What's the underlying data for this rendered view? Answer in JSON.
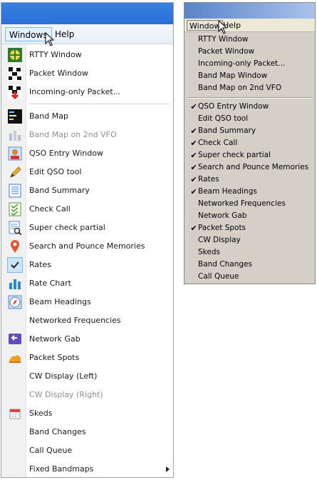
{
  "left_window": {
    "menubar": {
      "windows_label": "Windows",
      "help_label": "Help"
    },
    "menu_items": [
      {
        "label": "RTTY Window",
        "icon": "rtty-icon"
      },
      {
        "label": "Packet Window",
        "icon": "packet-icon"
      },
      {
        "label": "Incoming-only Packet...",
        "icon": "incoming-packet-icon"
      },
      {
        "label": "Band Map",
        "icon": "band-map-icon"
      },
      {
        "label": "Band Map on 2nd VFO",
        "icon": "band-map-2nd-vfo-icon",
        "disabled": true
      },
      {
        "label": "QSO Entry Window",
        "icon": "qso-entry-icon"
      },
      {
        "label": "Edit QSO tool",
        "icon": "pencil-icon"
      },
      {
        "label": "Band Summary",
        "icon": "band-summary-icon"
      },
      {
        "label": "Check Call",
        "icon": "check-call-icon"
      },
      {
        "label": "Super check partial",
        "icon": "super-check-partial-icon"
      },
      {
        "label": "Search and Pounce Memories",
        "icon": "map-pin-icon"
      },
      {
        "label": "Rates",
        "icon": "checkmark-icon",
        "checked": true
      },
      {
        "label": "Rate Chart",
        "icon": "rate-chart-icon"
      },
      {
        "label": "Beam Headings",
        "icon": "compass-icon"
      },
      {
        "label": "Networked Frequencies",
        "icon": ""
      },
      {
        "label": "Network Gab",
        "icon": "network-gab-icon"
      },
      {
        "label": "Packet Spots",
        "icon": "packet-spots-icon"
      },
      {
        "label": "CW Display (Left)",
        "icon": ""
      },
      {
        "label": "CW Display (Right)",
        "icon": "",
        "disabled": true
      },
      {
        "label": "Skeds",
        "icon": "calendar-icon"
      },
      {
        "label": "Band Changes",
        "icon": ""
      },
      {
        "label": "Call Queue",
        "icon": ""
      },
      {
        "label": "Fixed Bandmaps",
        "icon": "",
        "submenu": true
      }
    ]
  },
  "right_window": {
    "menubar": {
      "window_label": "Window",
      "help_label": "Help"
    },
    "menu_items": [
      {
        "label": "RTTY Window",
        "checked": false
      },
      {
        "label": "Packet Window",
        "checked": false
      },
      {
        "label": "Incoming-only Packet...",
        "checked": false
      },
      {
        "label": "Band Map Window",
        "checked": false
      },
      {
        "label": "Band Map on 2nd VFO",
        "checked": false
      },
      {
        "label": "QSO Entry Window",
        "checked": true
      },
      {
        "label": "Edit QSO tool",
        "checked": false
      },
      {
        "label": "Band Summary",
        "checked": true
      },
      {
        "label": "Check Call",
        "checked": true
      },
      {
        "label": "Super check partial",
        "checked": true
      },
      {
        "label": "Search and Pounce Memories",
        "checked": true
      },
      {
        "label": "Rates",
        "checked": true
      },
      {
        "label": "Beam Headings",
        "checked": true
      },
      {
        "label": "Networked Frequencies",
        "checked": false
      },
      {
        "label": "Network Gab",
        "checked": false
      },
      {
        "label": "Packet Spots",
        "checked": true
      },
      {
        "label": "CW Display",
        "checked": false
      },
      {
        "label": "Skeds",
        "checked": false
      },
      {
        "label": "Band Changes",
        "checked": false
      },
      {
        "label": "Call Queue",
        "checked": false
      }
    ],
    "check_glyph": "✔"
  },
  "colors": {
    "left_title_bar": "#2a6fd6",
    "right_title_bar_start": "#5a84c8",
    "right_title_bar_end": "#a9c2ea",
    "classic_menu_bg": "#d4d0c8"
  }
}
